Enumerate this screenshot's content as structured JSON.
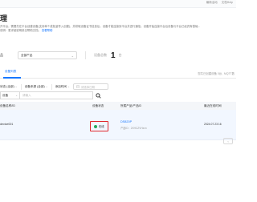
{
  "topbar": {
    "links": [
      "最新活动",
      "文档Help"
    ]
  },
  "page": {
    "title": "理",
    "description_lines": [
      "开平台。需要先在平台创建设备(支持单个或批量导入创建)，并获取设备证书信息后，设备才能连接到平台并进行通信。设备开始连接平台后设备与平台已经具有基础...",
      "说明：更详细说明参见帮助文档。"
    ],
    "description_link": "查看帮助"
  },
  "product_filter": {
    "label": "品",
    "value": "全部产品"
  },
  "device_total": {
    "label": "设备总数",
    "value": "1",
    "unit": "台"
  },
  "tabs": [
    {
      "label": "设备列表",
      "active": true
    }
  ],
  "tabs_right": "您共已创建设备 0台 , MQTT数",
  "filters": {
    "status": "状态 (全部)",
    "source": "设备来源 (全部)",
    "time": "添加时间",
    "date_placeholder": "请选择日期"
  },
  "search": {
    "type": "设备",
    "placeholder": "请输入"
  },
  "table": {
    "headers": [
      "设备名称/ID",
      "设备状态",
      "所属产品/产品ID",
      "最近在线时间"
    ],
    "rows": [
      {
        "name": "device001",
        "status": "在线",
        "status_color": "#25a85b",
        "product": "DS820P",
        "product_id": "产品ID：2XHCZVHzxn",
        "last_online": "2024.07.23 16"
      }
    ]
  }
}
